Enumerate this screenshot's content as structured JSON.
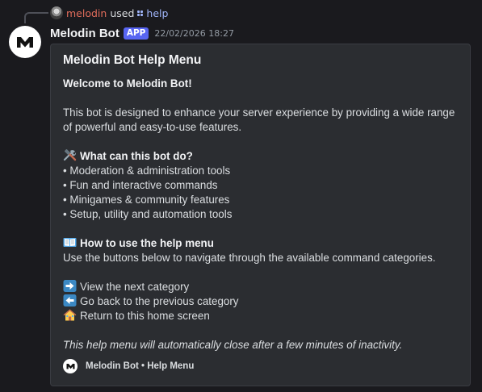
{
  "reply": {
    "username": "melodin",
    "action": "used",
    "command": "help"
  },
  "message": {
    "bot_name": "Melodin Bot",
    "badge": "APP",
    "timestamp": "22/02/2026 18:27"
  },
  "embed": {
    "title": "Melodin Bot Help Menu",
    "welcome": "Welcome to Melodin Bot!",
    "intro_line1": "This bot is designed to enhance your server experience by providing a wide range",
    "intro_line2": "of powerful and easy-to-use features.",
    "features_heading": "What can this bot do?",
    "features": [
      "• Moderation & administration tools",
      "• Fun and interactive commands",
      "• Minigames & community features",
      "• Setup, utility and automation tools"
    ],
    "howto_heading": "How to use the help menu",
    "howto_text": "Use the buttons below to navigate through the available command categories.",
    "nav_next": "View the next category",
    "nav_back": "Go back to the previous category",
    "nav_home": "Return to this home screen",
    "timeout_note": "This help menu will automatically close after a few minutes of inactivity.",
    "footer": "Melodin Bot • Help Menu"
  },
  "icons": {
    "reply_avatar": "user-avatar-icon",
    "command": "slash-command-icon",
    "bot_avatar": "melodin-logo-icon",
    "features": "hammer-wrench-icon",
    "howto": "open-book-icon",
    "next": "right-arrow-icon",
    "back": "left-arrow-icon",
    "home": "house-icon"
  },
  "colors": {
    "background": "#1a1a1e",
    "embed_background": "#2b2d31",
    "badge": "#5865f2",
    "username": "#e06c5b",
    "command": "#9fb4f8",
    "arrow_emoji": "#3b88c3"
  }
}
